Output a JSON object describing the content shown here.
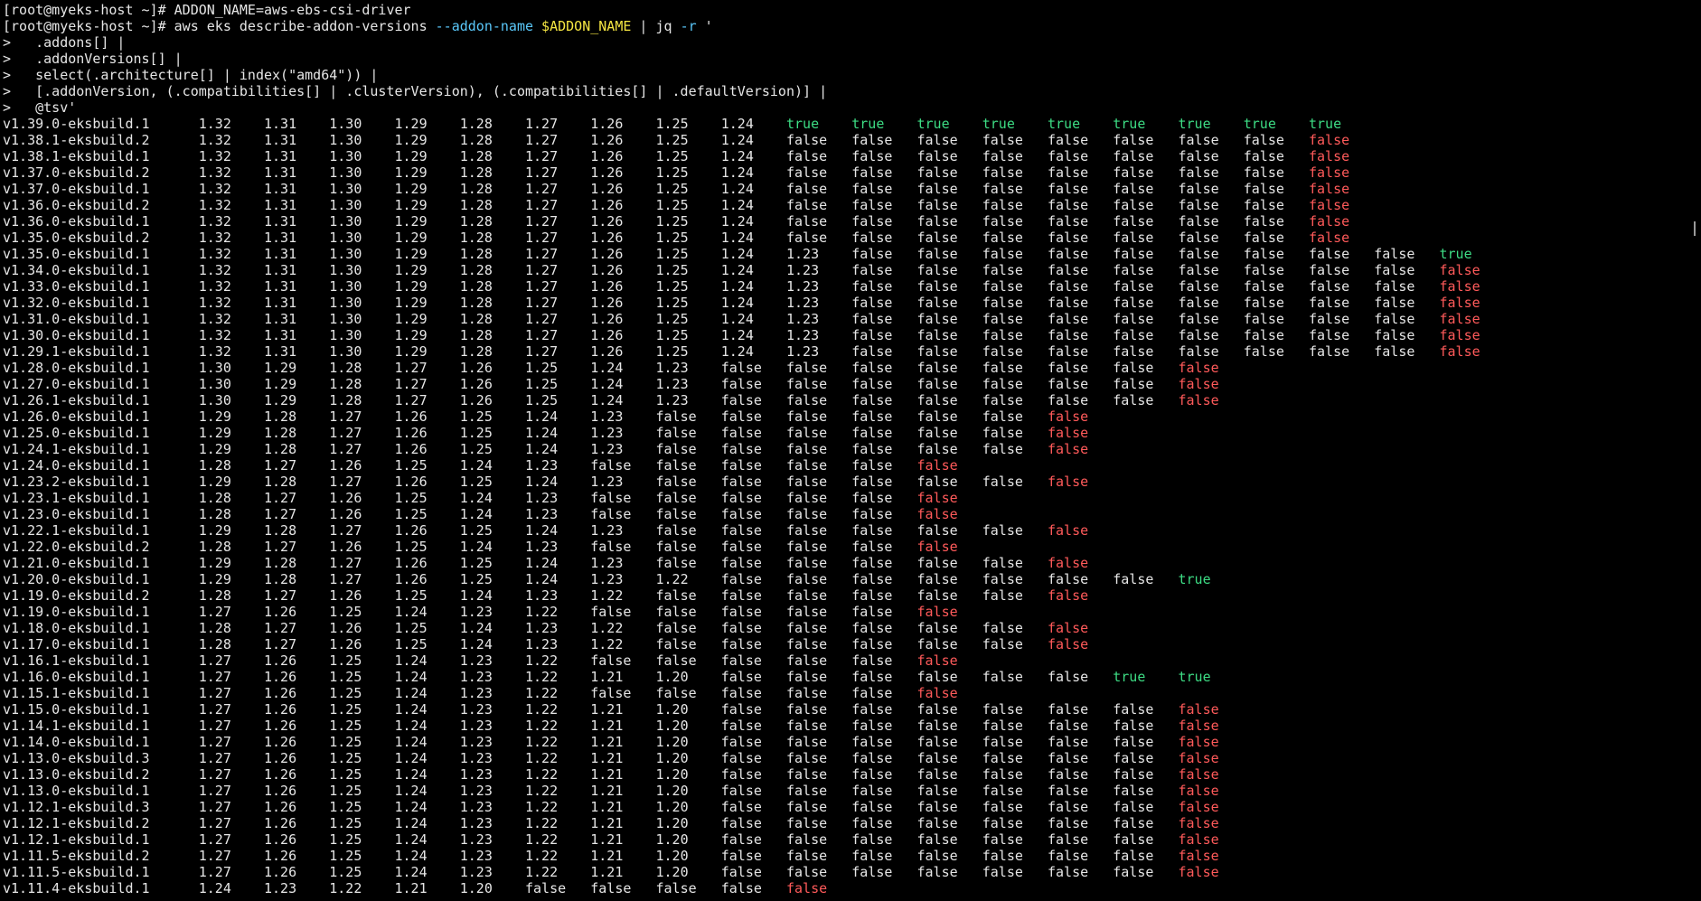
{
  "terminal": {
    "prompt": "[root@myeks-host ~]# ",
    "cmd1": "ADDON_NAME=aws-ebs-csi-driver",
    "cmd2_pre": "aws eks describe-addon-versions ",
    "cmd2_flag": "--addon-name",
    "cmd2_sp": " ",
    "cmd2_var": "$ADDON_NAME",
    "cmd2_pipe": " | jq ",
    "cmd2_flag2": "-r",
    "cmd2_quote": " '",
    "continuations": [
      ">   .addons[] |",
      ">   .addonVersions[] |",
      ">   select(.architecture[] | index(\"amd64\")) |",
      ">   [.addonVersion, (.compatibilities[] | .clusterVersion), (.compatibilities[] | .defaultVersion)] |",
      ">   @tsv'"
    ]
  },
  "colors": {
    "background": "#000000",
    "text": "#e6e6e6",
    "true": "#3ddc84",
    "last_false": "#ff5a5a",
    "flag": "#5ac8fa",
    "variable": "#f5e642"
  },
  "rows": [
    {
      "v": "v1.39.0-eksbuild.1",
      "k": [
        "1.32",
        "1.31",
        "1.30",
        "1.29",
        "1.28",
        "1.27",
        "1.26",
        "1.25",
        "1.24"
      ],
      "d": [
        "true",
        "true",
        "true",
        "true",
        "true",
        "true",
        "true",
        "true",
        "true"
      ]
    },
    {
      "v": "v1.38.1-eksbuild.2",
      "k": [
        "1.32",
        "1.31",
        "1.30",
        "1.29",
        "1.28",
        "1.27",
        "1.26",
        "1.25",
        "1.24"
      ],
      "d": [
        "false",
        "false",
        "false",
        "false",
        "false",
        "false",
        "false",
        "false",
        "false"
      ]
    },
    {
      "v": "v1.38.1-eksbuild.1",
      "k": [
        "1.32",
        "1.31",
        "1.30",
        "1.29",
        "1.28",
        "1.27",
        "1.26",
        "1.25",
        "1.24"
      ],
      "d": [
        "false",
        "false",
        "false",
        "false",
        "false",
        "false",
        "false",
        "false",
        "false"
      ]
    },
    {
      "v": "v1.37.0-eksbuild.2",
      "k": [
        "1.32",
        "1.31",
        "1.30",
        "1.29",
        "1.28",
        "1.27",
        "1.26",
        "1.25",
        "1.24"
      ],
      "d": [
        "false",
        "false",
        "false",
        "false",
        "false",
        "false",
        "false",
        "false",
        "false"
      ]
    },
    {
      "v": "v1.37.0-eksbuild.1",
      "k": [
        "1.32",
        "1.31",
        "1.30",
        "1.29",
        "1.28",
        "1.27",
        "1.26",
        "1.25",
        "1.24"
      ],
      "d": [
        "false",
        "false",
        "false",
        "false",
        "false",
        "false",
        "false",
        "false",
        "false"
      ]
    },
    {
      "v": "v1.36.0-eksbuild.2",
      "k": [
        "1.32",
        "1.31",
        "1.30",
        "1.29",
        "1.28",
        "1.27",
        "1.26",
        "1.25",
        "1.24"
      ],
      "d": [
        "false",
        "false",
        "false",
        "false",
        "false",
        "false",
        "false",
        "false",
        "false"
      ]
    },
    {
      "v": "v1.36.0-eksbuild.1",
      "k": [
        "1.32",
        "1.31",
        "1.30",
        "1.29",
        "1.28",
        "1.27",
        "1.26",
        "1.25",
        "1.24"
      ],
      "d": [
        "false",
        "false",
        "false",
        "false",
        "false",
        "false",
        "false",
        "false",
        "false"
      ]
    },
    {
      "v": "v1.35.0-eksbuild.2",
      "k": [
        "1.32",
        "1.31",
        "1.30",
        "1.29",
        "1.28",
        "1.27",
        "1.26",
        "1.25",
        "1.24"
      ],
      "d": [
        "false",
        "false",
        "false",
        "false",
        "false",
        "false",
        "false",
        "false",
        "false"
      ]
    },
    {
      "v": "v1.35.0-eksbuild.1",
      "k": [
        "1.32",
        "1.31",
        "1.30",
        "1.29",
        "1.28",
        "1.27",
        "1.26",
        "1.25",
        "1.24",
        "1.23"
      ],
      "d": [
        "false",
        "false",
        "false",
        "false",
        "false",
        "false",
        "false",
        "false",
        "false",
        "true"
      ]
    },
    {
      "v": "v1.34.0-eksbuild.1",
      "k": [
        "1.32",
        "1.31",
        "1.30",
        "1.29",
        "1.28",
        "1.27",
        "1.26",
        "1.25",
        "1.24",
        "1.23"
      ],
      "d": [
        "false",
        "false",
        "false",
        "false",
        "false",
        "false",
        "false",
        "false",
        "false",
        "false"
      ]
    },
    {
      "v": "v1.33.0-eksbuild.1",
      "k": [
        "1.32",
        "1.31",
        "1.30",
        "1.29",
        "1.28",
        "1.27",
        "1.26",
        "1.25",
        "1.24",
        "1.23"
      ],
      "d": [
        "false",
        "false",
        "false",
        "false",
        "false",
        "false",
        "false",
        "false",
        "false",
        "false"
      ]
    },
    {
      "v": "v1.32.0-eksbuild.1",
      "k": [
        "1.32",
        "1.31",
        "1.30",
        "1.29",
        "1.28",
        "1.27",
        "1.26",
        "1.25",
        "1.24",
        "1.23"
      ],
      "d": [
        "false",
        "false",
        "false",
        "false",
        "false",
        "false",
        "false",
        "false",
        "false",
        "false"
      ]
    },
    {
      "v": "v1.31.0-eksbuild.1",
      "k": [
        "1.32",
        "1.31",
        "1.30",
        "1.29",
        "1.28",
        "1.27",
        "1.26",
        "1.25",
        "1.24",
        "1.23"
      ],
      "d": [
        "false",
        "false",
        "false",
        "false",
        "false",
        "false",
        "false",
        "false",
        "false",
        "false"
      ]
    },
    {
      "v": "v1.30.0-eksbuild.1",
      "k": [
        "1.32",
        "1.31",
        "1.30",
        "1.29",
        "1.28",
        "1.27",
        "1.26",
        "1.25",
        "1.24",
        "1.23"
      ],
      "d": [
        "false",
        "false",
        "false",
        "false",
        "false",
        "false",
        "false",
        "false",
        "false",
        "false"
      ]
    },
    {
      "v": "v1.29.1-eksbuild.1",
      "k": [
        "1.32",
        "1.31",
        "1.30",
        "1.29",
        "1.28",
        "1.27",
        "1.26",
        "1.25",
        "1.24",
        "1.23"
      ],
      "d": [
        "false",
        "false",
        "false",
        "false",
        "false",
        "false",
        "false",
        "false",
        "false",
        "false"
      ]
    },
    {
      "v": "v1.28.0-eksbuild.1",
      "k": [
        "1.30",
        "1.29",
        "1.28",
        "1.27",
        "1.26",
        "1.25",
        "1.24",
        "1.23"
      ],
      "d": [
        "false",
        "false",
        "false",
        "false",
        "false",
        "false",
        "false",
        "false"
      ]
    },
    {
      "v": "v1.27.0-eksbuild.1",
      "k": [
        "1.30",
        "1.29",
        "1.28",
        "1.27",
        "1.26",
        "1.25",
        "1.24",
        "1.23"
      ],
      "d": [
        "false",
        "false",
        "false",
        "false",
        "false",
        "false",
        "false",
        "false"
      ]
    },
    {
      "v": "v1.26.1-eksbuild.1",
      "k": [
        "1.30",
        "1.29",
        "1.28",
        "1.27",
        "1.26",
        "1.25",
        "1.24",
        "1.23"
      ],
      "d": [
        "false",
        "false",
        "false",
        "false",
        "false",
        "false",
        "false",
        "false"
      ]
    },
    {
      "v": "v1.26.0-eksbuild.1",
      "k": [
        "1.29",
        "1.28",
        "1.27",
        "1.26",
        "1.25",
        "1.24",
        "1.23"
      ],
      "d": [
        "false",
        "false",
        "false",
        "false",
        "false",
        "false",
        "false"
      ]
    },
    {
      "v": "v1.25.0-eksbuild.1",
      "k": [
        "1.29",
        "1.28",
        "1.27",
        "1.26",
        "1.25",
        "1.24",
        "1.23"
      ],
      "d": [
        "false",
        "false",
        "false",
        "false",
        "false",
        "false",
        "false"
      ]
    },
    {
      "v": "v1.24.1-eksbuild.1",
      "k": [
        "1.29",
        "1.28",
        "1.27",
        "1.26",
        "1.25",
        "1.24",
        "1.23"
      ],
      "d": [
        "false",
        "false",
        "false",
        "false",
        "false",
        "false",
        "false"
      ]
    },
    {
      "v": "v1.24.0-eksbuild.1",
      "k": [
        "1.28",
        "1.27",
        "1.26",
        "1.25",
        "1.24",
        "1.23"
      ],
      "d": [
        "false",
        "false",
        "false",
        "false",
        "false",
        "false"
      ]
    },
    {
      "v": "v1.23.2-eksbuild.1",
      "k": [
        "1.29",
        "1.28",
        "1.27",
        "1.26",
        "1.25",
        "1.24",
        "1.23"
      ],
      "d": [
        "false",
        "false",
        "false",
        "false",
        "false",
        "false",
        "false"
      ]
    },
    {
      "v": "v1.23.1-eksbuild.1",
      "k": [
        "1.28",
        "1.27",
        "1.26",
        "1.25",
        "1.24",
        "1.23"
      ],
      "d": [
        "false",
        "false",
        "false",
        "false",
        "false",
        "false"
      ]
    },
    {
      "v": "v1.23.0-eksbuild.1",
      "k": [
        "1.28",
        "1.27",
        "1.26",
        "1.25",
        "1.24",
        "1.23"
      ],
      "d": [
        "false",
        "false",
        "false",
        "false",
        "false",
        "false"
      ]
    },
    {
      "v": "v1.22.1-eksbuild.1",
      "k": [
        "1.29",
        "1.28",
        "1.27",
        "1.26",
        "1.25",
        "1.24",
        "1.23"
      ],
      "d": [
        "false",
        "false",
        "false",
        "false",
        "false",
        "false",
        "false"
      ]
    },
    {
      "v": "v1.22.0-eksbuild.2",
      "k": [
        "1.28",
        "1.27",
        "1.26",
        "1.25",
        "1.24",
        "1.23"
      ],
      "d": [
        "false",
        "false",
        "false",
        "false",
        "false",
        "false"
      ]
    },
    {
      "v": "v1.21.0-eksbuild.1",
      "k": [
        "1.29",
        "1.28",
        "1.27",
        "1.26",
        "1.25",
        "1.24",
        "1.23"
      ],
      "d": [
        "false",
        "false",
        "false",
        "false",
        "false",
        "false",
        "false"
      ]
    },
    {
      "v": "v1.20.0-eksbuild.1",
      "k": [
        "1.29",
        "1.28",
        "1.27",
        "1.26",
        "1.25",
        "1.24",
        "1.23",
        "1.22"
      ],
      "d": [
        "false",
        "false",
        "false",
        "false",
        "false",
        "false",
        "false",
        "true"
      ]
    },
    {
      "v": "v1.19.0-eksbuild.2",
      "k": [
        "1.28",
        "1.27",
        "1.26",
        "1.25",
        "1.24",
        "1.23",
        "1.22"
      ],
      "d": [
        "false",
        "false",
        "false",
        "false",
        "false",
        "false",
        "false"
      ]
    },
    {
      "v": "v1.19.0-eksbuild.1",
      "k": [
        "1.27",
        "1.26",
        "1.25",
        "1.24",
        "1.23",
        "1.22"
      ],
      "d": [
        "false",
        "false",
        "false",
        "false",
        "false",
        "false"
      ]
    },
    {
      "v": "v1.18.0-eksbuild.1",
      "k": [
        "1.28",
        "1.27",
        "1.26",
        "1.25",
        "1.24",
        "1.23",
        "1.22"
      ],
      "d": [
        "false",
        "false",
        "false",
        "false",
        "false",
        "false",
        "false"
      ]
    },
    {
      "v": "v1.17.0-eksbuild.1",
      "k": [
        "1.28",
        "1.27",
        "1.26",
        "1.25",
        "1.24",
        "1.23",
        "1.22"
      ],
      "d": [
        "false",
        "false",
        "false",
        "false",
        "false",
        "false",
        "false"
      ]
    },
    {
      "v": "v1.16.1-eksbuild.1",
      "k": [
        "1.27",
        "1.26",
        "1.25",
        "1.24",
        "1.23",
        "1.22"
      ],
      "d": [
        "false",
        "false",
        "false",
        "false",
        "false",
        "false"
      ]
    },
    {
      "v": "v1.16.0-eksbuild.1",
      "k": [
        "1.27",
        "1.26",
        "1.25",
        "1.24",
        "1.23",
        "1.22",
        "1.21",
        "1.20"
      ],
      "d": [
        "false",
        "false",
        "false",
        "false",
        "false",
        "false",
        "true",
        "true"
      ]
    },
    {
      "v": "v1.15.1-eksbuild.1",
      "k": [
        "1.27",
        "1.26",
        "1.25",
        "1.24",
        "1.23",
        "1.22"
      ],
      "d": [
        "false",
        "false",
        "false",
        "false",
        "false",
        "false"
      ]
    },
    {
      "v": "v1.15.0-eksbuild.1",
      "k": [
        "1.27",
        "1.26",
        "1.25",
        "1.24",
        "1.23",
        "1.22",
        "1.21",
        "1.20"
      ],
      "d": [
        "false",
        "false",
        "false",
        "false",
        "false",
        "false",
        "false",
        "false"
      ]
    },
    {
      "v": "v1.14.1-eksbuild.1",
      "k": [
        "1.27",
        "1.26",
        "1.25",
        "1.24",
        "1.23",
        "1.22",
        "1.21",
        "1.20"
      ],
      "d": [
        "false",
        "false",
        "false",
        "false",
        "false",
        "false",
        "false",
        "false"
      ]
    },
    {
      "v": "v1.14.0-eksbuild.1",
      "k": [
        "1.27",
        "1.26",
        "1.25",
        "1.24",
        "1.23",
        "1.22",
        "1.21",
        "1.20"
      ],
      "d": [
        "false",
        "false",
        "false",
        "false",
        "false",
        "false",
        "false",
        "false"
      ]
    },
    {
      "v": "v1.13.0-eksbuild.3",
      "k": [
        "1.27",
        "1.26",
        "1.25",
        "1.24",
        "1.23",
        "1.22",
        "1.21",
        "1.20"
      ],
      "d": [
        "false",
        "false",
        "false",
        "false",
        "false",
        "false",
        "false",
        "false"
      ]
    },
    {
      "v": "v1.13.0-eksbuild.2",
      "k": [
        "1.27",
        "1.26",
        "1.25",
        "1.24",
        "1.23",
        "1.22",
        "1.21",
        "1.20"
      ],
      "d": [
        "false",
        "false",
        "false",
        "false",
        "false",
        "false",
        "false",
        "false"
      ]
    },
    {
      "v": "v1.13.0-eksbuild.1",
      "k": [
        "1.27",
        "1.26",
        "1.25",
        "1.24",
        "1.23",
        "1.22",
        "1.21",
        "1.20"
      ],
      "d": [
        "false",
        "false",
        "false",
        "false",
        "false",
        "false",
        "false",
        "false"
      ]
    },
    {
      "v": "v1.12.1-eksbuild.3",
      "k": [
        "1.27",
        "1.26",
        "1.25",
        "1.24",
        "1.23",
        "1.22",
        "1.21",
        "1.20"
      ],
      "d": [
        "false",
        "false",
        "false",
        "false",
        "false",
        "false",
        "false",
        "false"
      ]
    },
    {
      "v": "v1.12.1-eksbuild.2",
      "k": [
        "1.27",
        "1.26",
        "1.25",
        "1.24",
        "1.23",
        "1.22",
        "1.21",
        "1.20"
      ],
      "d": [
        "false",
        "false",
        "false",
        "false",
        "false",
        "false",
        "false",
        "false"
      ]
    },
    {
      "v": "v1.12.1-eksbuild.1",
      "k": [
        "1.27",
        "1.26",
        "1.25",
        "1.24",
        "1.23",
        "1.22",
        "1.21",
        "1.20"
      ],
      "d": [
        "false",
        "false",
        "false",
        "false",
        "false",
        "false",
        "false",
        "false"
      ]
    },
    {
      "v": "v1.11.5-eksbuild.2",
      "k": [
        "1.27",
        "1.26",
        "1.25",
        "1.24",
        "1.23",
        "1.22",
        "1.21",
        "1.20"
      ],
      "d": [
        "false",
        "false",
        "false",
        "false",
        "false",
        "false",
        "false",
        "false"
      ]
    },
    {
      "v": "v1.11.5-eksbuild.1",
      "k": [
        "1.27",
        "1.26",
        "1.25",
        "1.24",
        "1.23",
        "1.22",
        "1.21",
        "1.20"
      ],
      "d": [
        "false",
        "false",
        "false",
        "false",
        "false",
        "false",
        "false",
        "false"
      ]
    },
    {
      "v": "v1.11.4-eksbuild.1",
      "k": [
        "1.24",
        "1.23",
        "1.22",
        "1.21",
        "1.20"
      ],
      "d": [
        "false",
        "false",
        "false",
        "false",
        "false"
      ]
    }
  ]
}
